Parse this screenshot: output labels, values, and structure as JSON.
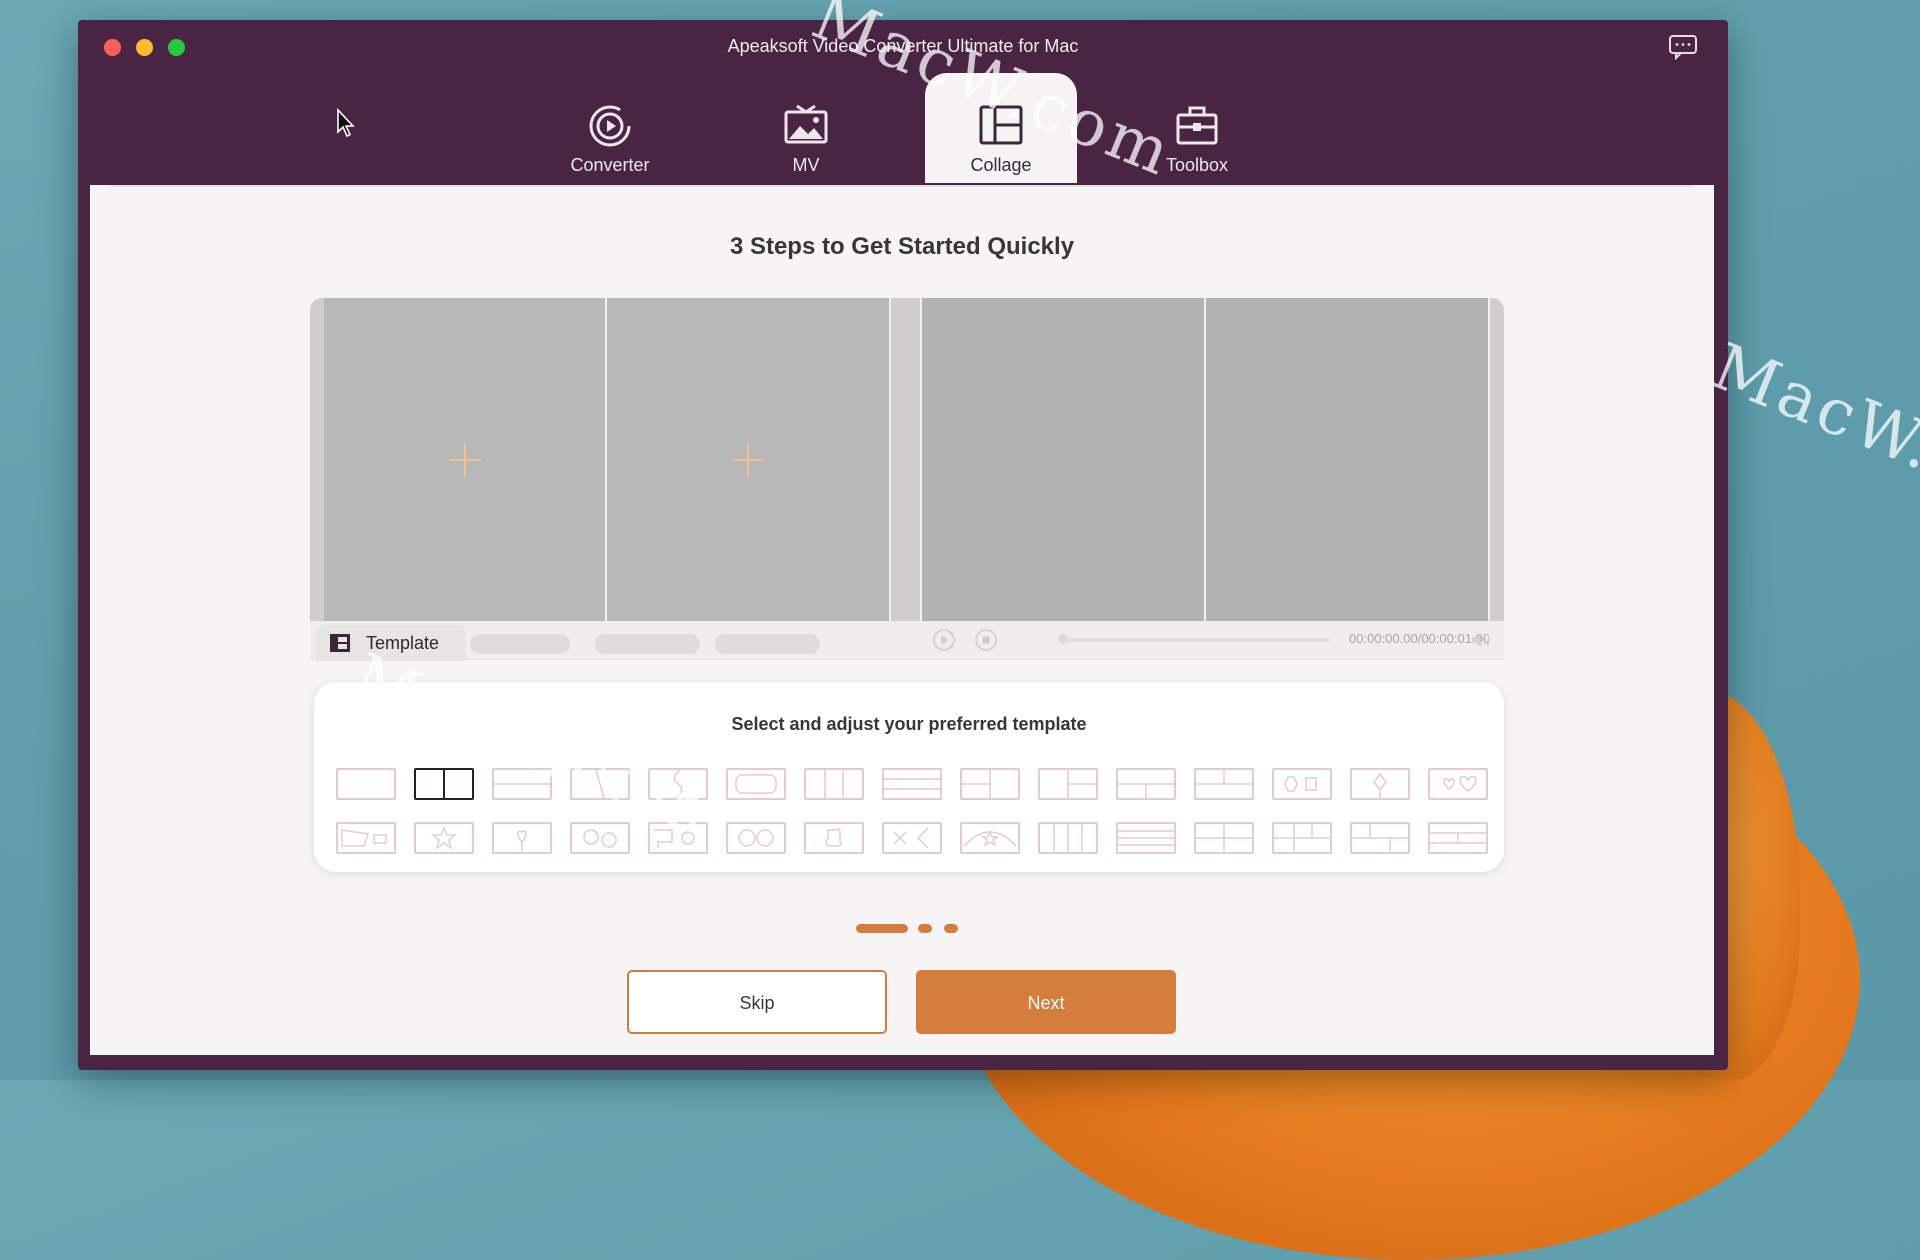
{
  "window": {
    "title": "Apeaksoft Video Converter Ultimate for Mac"
  },
  "nav": {
    "tabs": [
      {
        "label": "Converter",
        "icon": "converter-icon"
      },
      {
        "label": "MV",
        "icon": "mv-icon"
      },
      {
        "label": "Collage",
        "icon": "collage-icon",
        "active": true
      },
      {
        "label": "Toolbox",
        "icon": "toolbox-icon"
      }
    ]
  },
  "main": {
    "heading": "3 Steps to Get Started Quickly",
    "preview": {
      "template_tab_label": "Template",
      "time_readout": "00:00:00.00/00:00:01.00"
    },
    "template_panel": {
      "title": "Select and adjust your preferred template",
      "row1": [
        "single",
        "two-columns",
        "two-rows",
        "diagonal-split",
        "wave-split",
        "rounded-rect",
        "three-columns",
        "three-rows",
        "left-right-split",
        "l-shape",
        "t-shape-rows",
        "cross-grid",
        "hexagon-square",
        "diamond-split",
        "hearts"
      ],
      "row2": [
        "banner",
        "star",
        "heart-center",
        "circles",
        "sun-frame",
        "two-circles",
        "puzzle",
        "x-split",
        "star-arc",
        "four-columns",
        "four-rows",
        "four-grid",
        "offset-grid",
        "t-grid",
        "rows-grid"
      ],
      "selected_index": 1
    },
    "step_indicator": {
      "total_steps": 3,
      "current_step": 1
    },
    "buttons": {
      "skip": "Skip",
      "next": "Next"
    }
  },
  "colors": {
    "titlebar": "#4a2543",
    "accent": "#d47d3d",
    "plus_icon": "#f2c48d",
    "template_outline": "#e6c9d6"
  },
  "watermark": "MacW.com"
}
